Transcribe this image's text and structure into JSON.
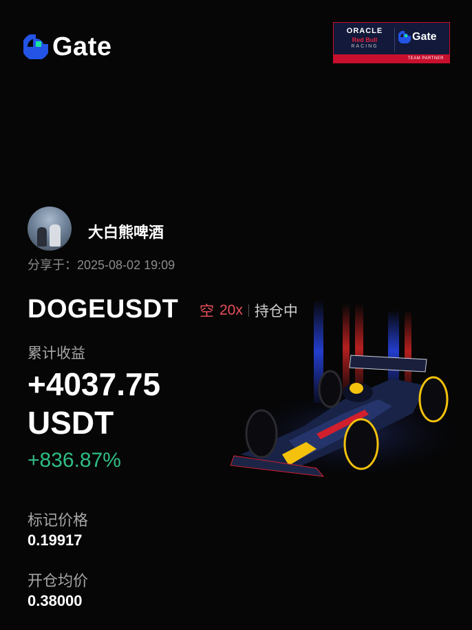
{
  "brand": {
    "name": "Gate",
    "accent": "#2354e6",
    "mark_green": "#17e6a1"
  },
  "partner_badge": {
    "oracle": "ORACLE",
    "red_bull": "Red Bull",
    "racing": "RACING",
    "gate": "Gate",
    "footer": "TEAM PARTNER"
  },
  "user": {
    "name": "大白熊啤酒"
  },
  "share": {
    "text": "分享于：2025-08-02 19:09"
  },
  "position": {
    "pair": "DOGEUSDT",
    "side": "空",
    "leverage": "20x",
    "status": "持仓中"
  },
  "pnl": {
    "label": "累计收益",
    "value": "+4037.75",
    "unit": "USDT",
    "percent": "+836.87%",
    "color_positive": "#2fbd85"
  },
  "mark_price": {
    "label": "标记价格",
    "value": "0.19917"
  },
  "entry_price": {
    "label": "开仓均价",
    "value": "0.38000"
  },
  "icons": [
    "gate-logo-icon",
    "avatar-image",
    "f1-car-image"
  ]
}
